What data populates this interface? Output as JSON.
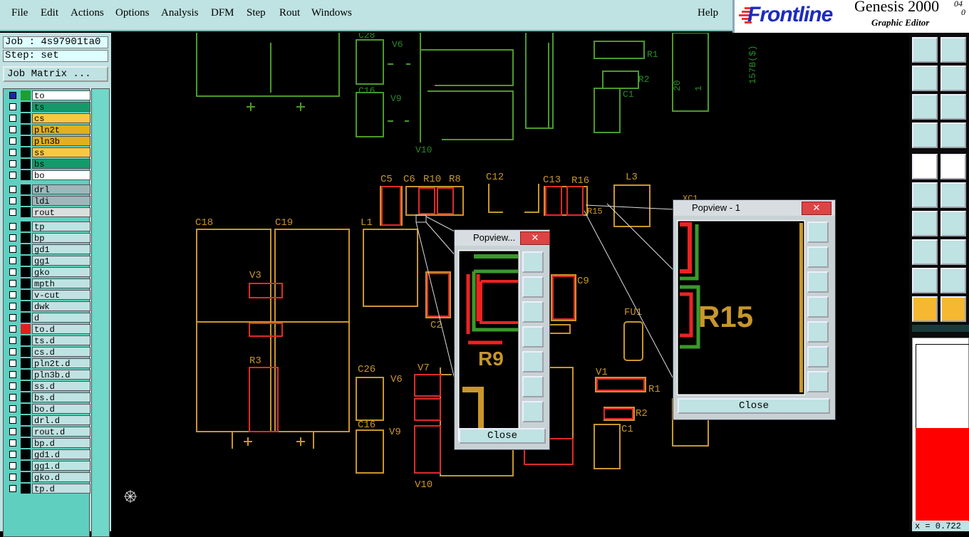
{
  "menu": [
    "File",
    "Edit",
    "Actions",
    "Options",
    "Analysis",
    "DFM",
    "Step",
    "Rout",
    "Windows"
  ],
  "help": "Help",
  "brand": {
    "logo": "Frontline",
    "product": "Genesis 2000",
    "subtitle": "Graphic Editor",
    "version_top": "04",
    "version_bottom": "0"
  },
  "job_label": "Job : 4s97901ta0",
  "step_label": "Step: set",
  "job_matrix_button": "Job Matrix ...",
  "layers": [
    {
      "name": "to",
      "color": "#ffffff",
      "sw": "#1aa032"
    },
    {
      "name": "ts",
      "color": "#149a6a",
      "sw": "#000000"
    },
    {
      "name": "cs",
      "color": "#f7c842",
      "sw": "#000000"
    },
    {
      "name": "pln2t",
      "color": "#e0b020",
      "sw": "#000000"
    },
    {
      "name": "pln3b",
      "color": "#e0b020",
      "sw": "#000000"
    },
    {
      "name": "ss",
      "color": "#f7c842",
      "sw": "#000000"
    },
    {
      "name": "bs",
      "color": "#149a6a",
      "sw": "#000000"
    },
    {
      "name": "bo",
      "color": "#ffffff",
      "sw": "#000000"
    },
    {
      "name": "drl",
      "color": "#9fb7bb",
      "sw": "#000000"
    },
    {
      "name": "ldi",
      "color": "#9fb7bb",
      "sw": "#000000"
    },
    {
      "name": "rout",
      "color": "#d9dede",
      "sw": "#000000"
    },
    {
      "name": "tp",
      "color": "#bfe2e2",
      "sw": "#000000"
    },
    {
      "name": "bp",
      "color": "#bfe2e2",
      "sw": "#000000"
    },
    {
      "name": "gd1",
      "color": "#bfe2e2",
      "sw": "#000000"
    },
    {
      "name": "gg1",
      "color": "#bfe2e2",
      "sw": "#000000"
    },
    {
      "name": "gko",
      "color": "#bfe2e2",
      "sw": "#000000"
    },
    {
      "name": "mpth",
      "color": "#bfe2e2",
      "sw": "#000000"
    },
    {
      "name": "v-cut",
      "color": "#bfe2e2",
      "sw": "#000000"
    },
    {
      "name": "dwk",
      "color": "#bfe2e2",
      "sw": "#000000"
    },
    {
      "name": "d",
      "color": "#bfe2e2",
      "sw": "#000000"
    },
    {
      "name": "to.d",
      "color": "#bfe2e2",
      "sw": "#e02020"
    },
    {
      "name": "ts.d",
      "color": "#bfe2e2",
      "sw": "#000000"
    },
    {
      "name": "cs.d",
      "color": "#bfe2e2",
      "sw": "#000000"
    },
    {
      "name": "pln2t.d",
      "color": "#bfe2e2",
      "sw": "#000000"
    },
    {
      "name": "pln3b.d",
      "color": "#bfe2e2",
      "sw": "#000000"
    },
    {
      "name": "ss.d",
      "color": "#bfe2e2",
      "sw": "#000000"
    },
    {
      "name": "bs.d",
      "color": "#bfe2e2",
      "sw": "#000000"
    },
    {
      "name": "bo.d",
      "color": "#bfe2e2",
      "sw": "#000000"
    },
    {
      "name": "drl.d",
      "color": "#bfe2e2",
      "sw": "#000000"
    },
    {
      "name": "rout.d",
      "color": "#bfe2e2",
      "sw": "#000000"
    },
    {
      "name": "bp.d",
      "color": "#bfe2e2",
      "sw": "#000000"
    },
    {
      "name": "gd1.d",
      "color": "#bfe2e2",
      "sw": "#000000"
    },
    {
      "name": "gg1.d",
      "color": "#bfe2e2",
      "sw": "#000000"
    },
    {
      "name": "gko.d",
      "color": "#bfe2e2",
      "sw": "#000000"
    },
    {
      "name": "tp.d",
      "color": "#bfe2e2",
      "sw": "#000000"
    }
  ],
  "canvas_labels": {
    "c28": "C28",
    "v6": "V6",
    "c16": "C16",
    "v9": "V9",
    "v10": "V10",
    "r1": "R1",
    "r2": "R2",
    "c1": "C1",
    "n20": "20",
    "n1": "1",
    "vert": "157B($)",
    "c5": "C5",
    "c6": "C6",
    "r10": "R10",
    "r8": "R8",
    "c12": "C12",
    "c13": "C13",
    "r16": "R16",
    "l3": "L3",
    "c18": "C18",
    "c19": "C19",
    "l1": "L1",
    "r15": "R15",
    "v3": "V3",
    "r3": "R3",
    "c9": "C9",
    "c2": "C2",
    "fu1": "FU1",
    "c26": "C26",
    "v7": "V7",
    "v1": "V1",
    "xc1": "XC1"
  },
  "popview1": {
    "title": "Popview - 1",
    "close": "Close",
    "zoom_label": "R15"
  },
  "popview2": {
    "title": "Popview...",
    "close": "Close",
    "zoom_label": "R9"
  },
  "coord": "x = 0.722"
}
